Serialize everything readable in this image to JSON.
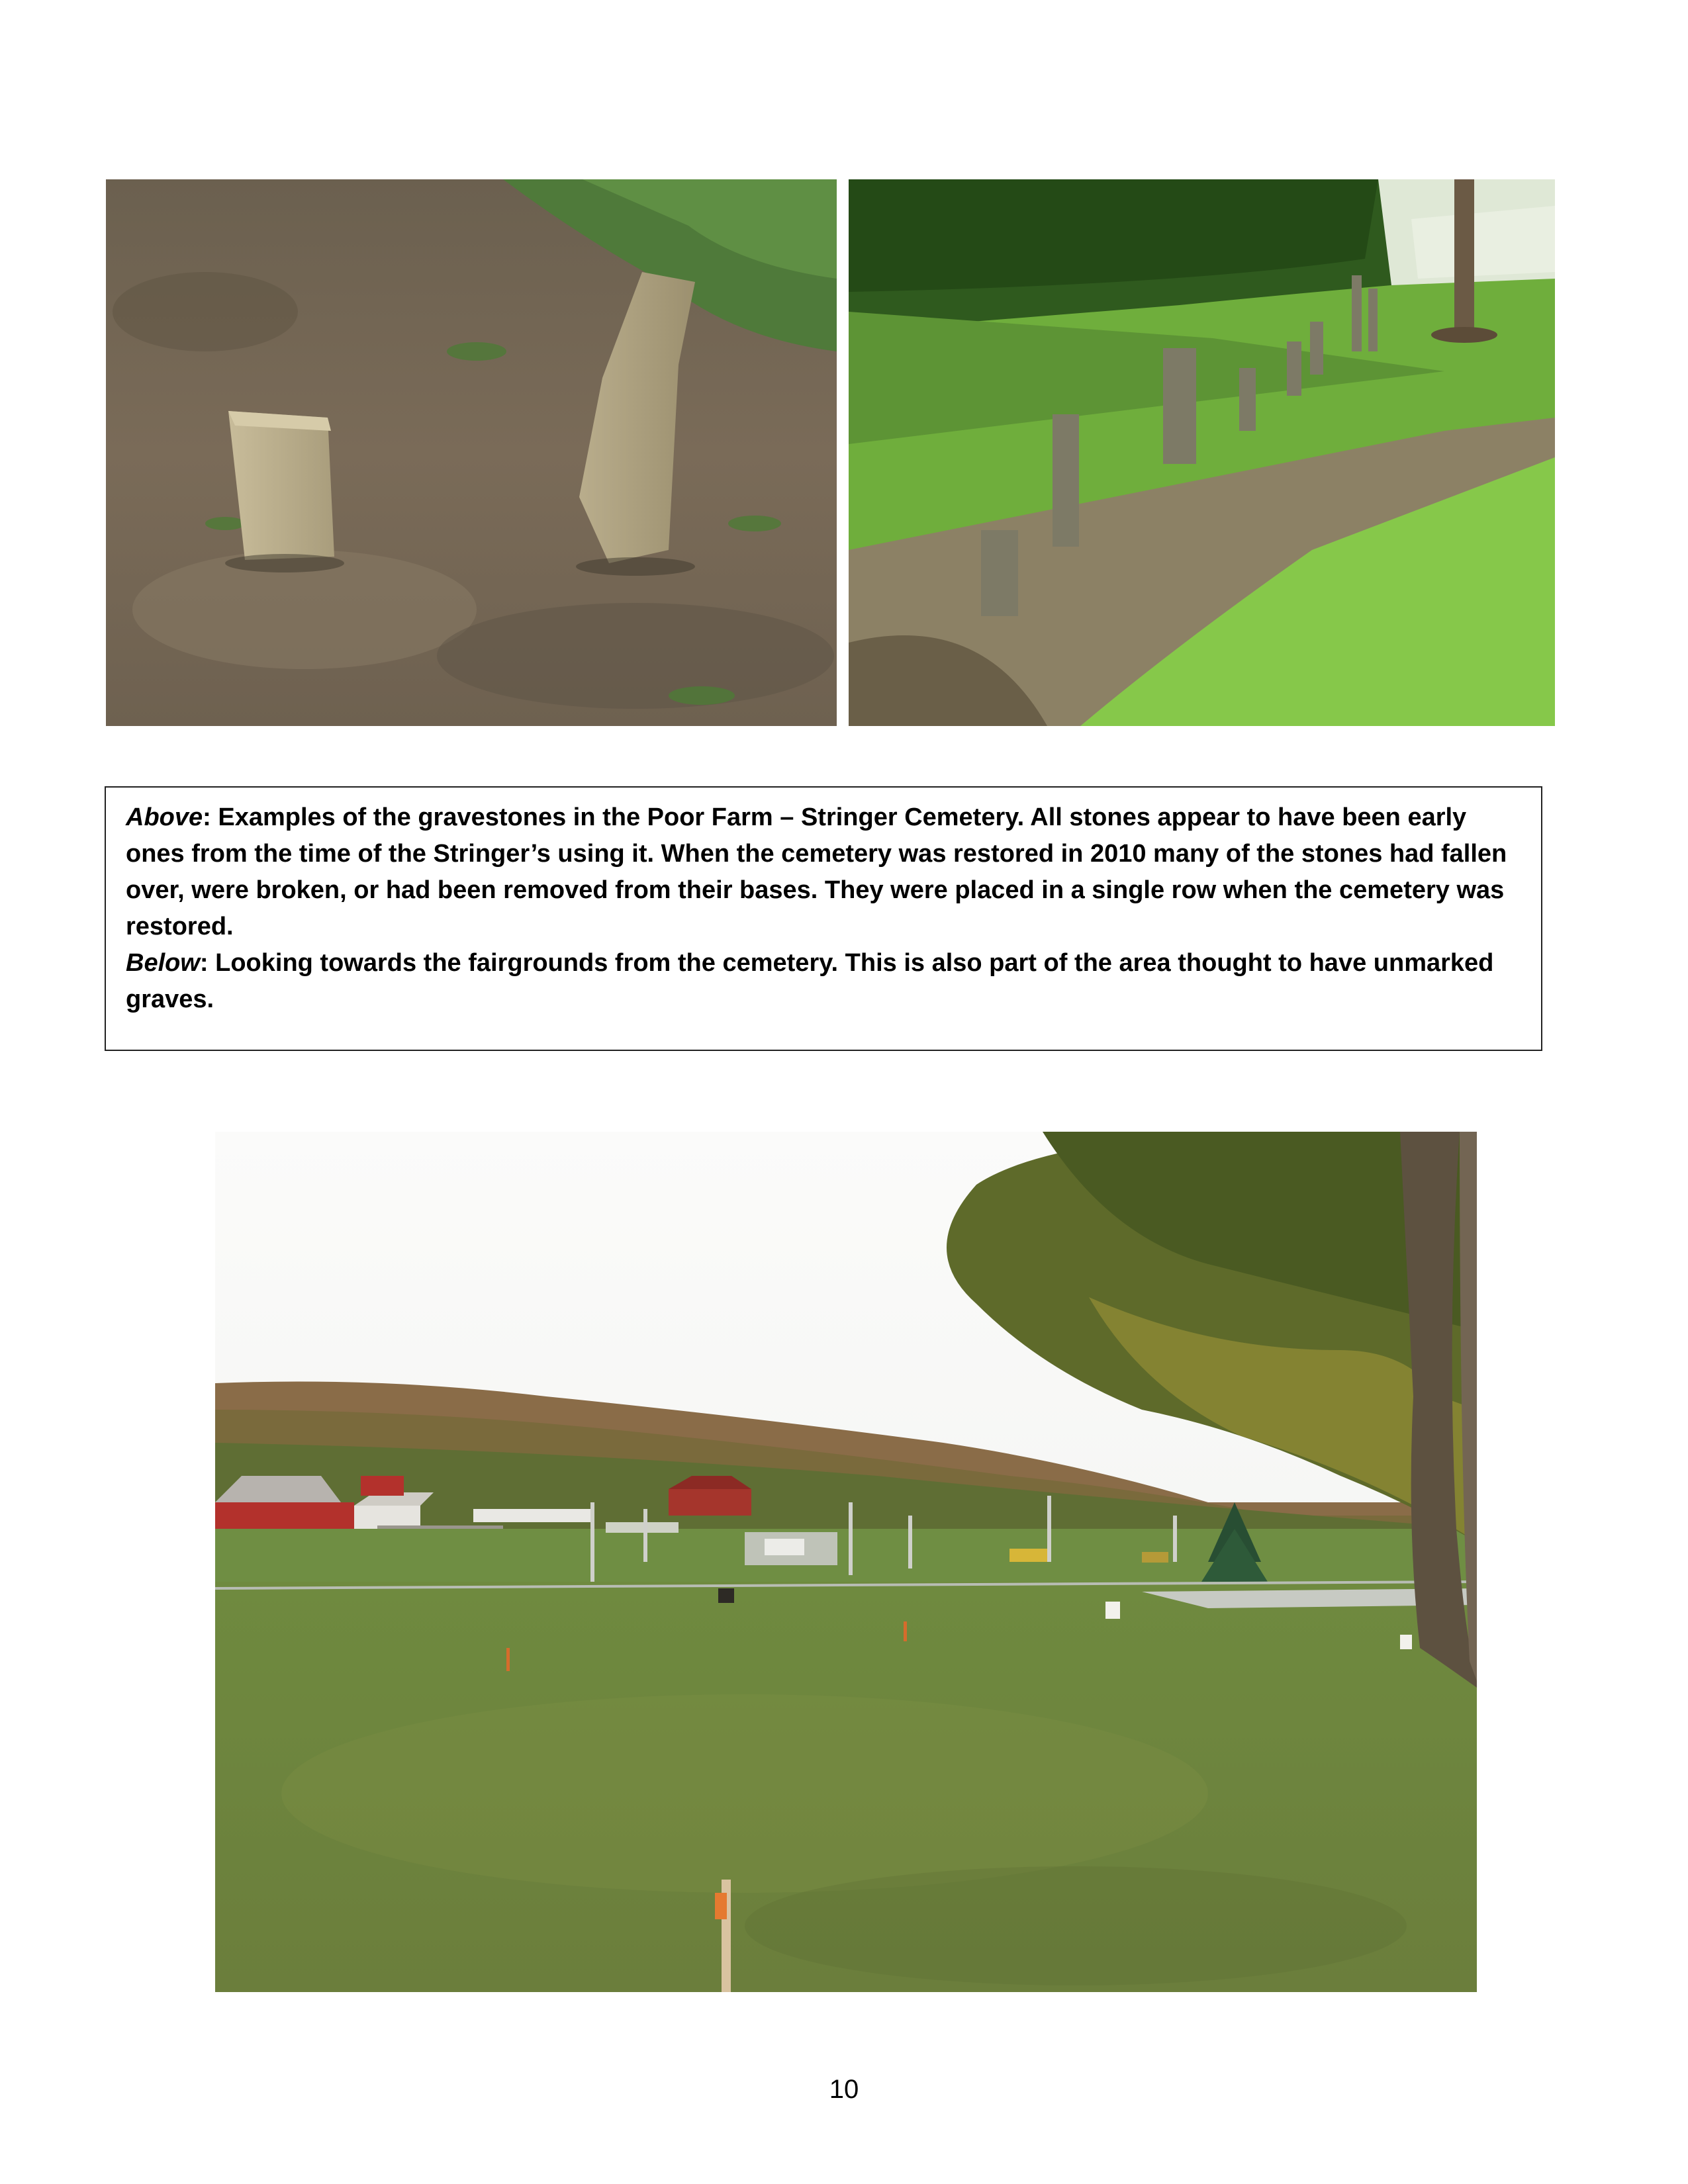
{
  "photos": {
    "top_left": "gravestones-closeup-photo",
    "top_right": "gravestone-row-photo",
    "bottom": "fairgrounds-view-photo"
  },
  "caption": {
    "above_label": "Above",
    "above_text": ": Examples of the gravestones in the Poor Farm – Stringer Cemetery. All stones appear to have been early ones from the time of the Stringer’s using it. When the cemetery was restored in 2010 many of the stones had fallen over, were broken, or had been removed from their bases.  They were placed in a single row when the cemetery was restored.",
    "below_label": "Below",
    "below_text": ": Looking towards the fairgrounds from the cemetery. This is also part of the area thought to have unmarked graves."
  },
  "page_number": "10"
}
